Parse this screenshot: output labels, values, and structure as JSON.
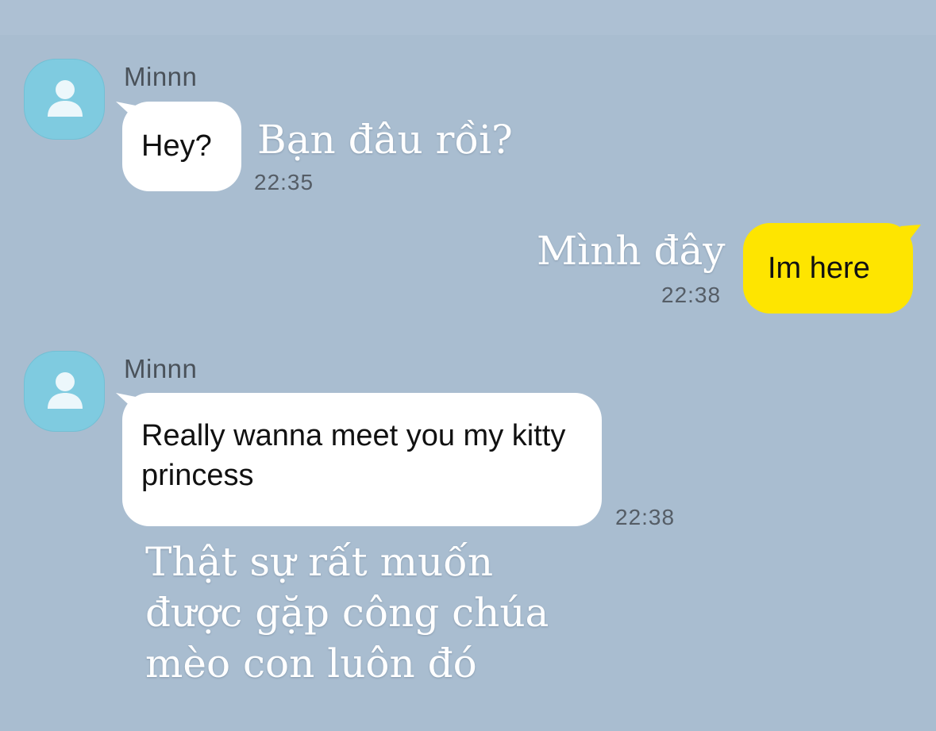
{
  "messages": [
    {
      "sender": "Minnn",
      "text": "Hey?",
      "time": "22:35",
      "translation": "Bạn đâu rồi?"
    },
    {
      "sender": "",
      "text": "Im here",
      "time": "22:38",
      "translation": "Mình đây"
    },
    {
      "sender": "Minnn",
      "text": "Really wanna meet you my kitty princess",
      "time": "22:38",
      "translation": "Thật sự rất muốn được gặp công chúa mèo con luôn đó"
    }
  ],
  "icons": {
    "avatar": "default-user-avatar-icon"
  },
  "colors": {
    "background": "#a9bdd0",
    "incoming_bubble": "#ffffff",
    "outgoing_bubble": "#fee500",
    "avatar": "#7fcbe0"
  }
}
